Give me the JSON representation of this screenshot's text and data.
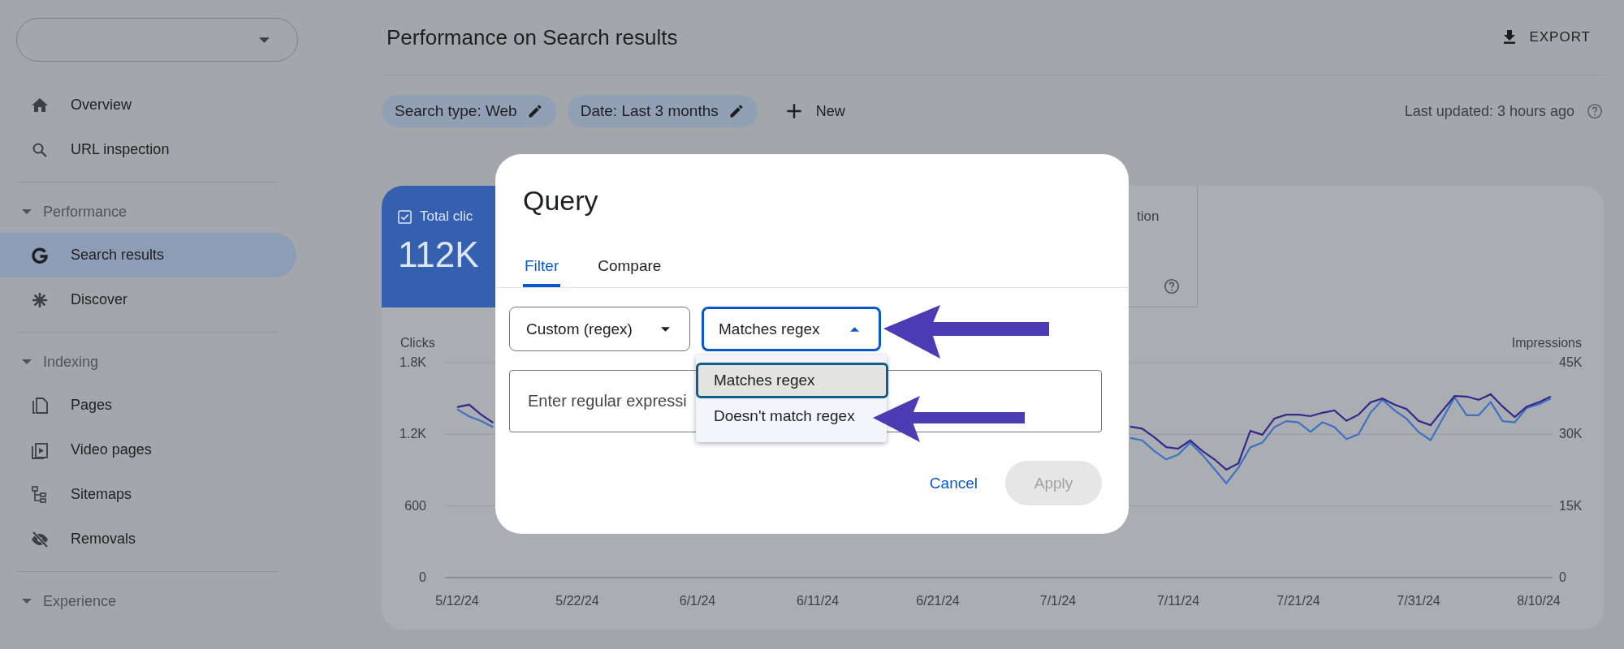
{
  "sidebar": {
    "sections": [
      {
        "items": [
          {
            "label": "Overview",
            "selected": false
          },
          {
            "label": "URL inspection",
            "selected": false
          }
        ]
      },
      {
        "heading": "Performance",
        "expanded": true,
        "items": [
          {
            "label": "Search results",
            "selected": true
          },
          {
            "label": "Discover",
            "selected": false
          }
        ]
      },
      {
        "heading": "Indexing",
        "expanded": true,
        "items": [
          {
            "label": "Pages",
            "selected": false
          },
          {
            "label": "Video pages",
            "selected": false
          },
          {
            "label": "Sitemaps",
            "selected": false
          },
          {
            "label": "Removals",
            "selected": false
          }
        ]
      },
      {
        "heading": "Experience",
        "expanded": true
      }
    ]
  },
  "header": {
    "title": "Performance on Search results",
    "export": "EXPORT",
    "filters": [
      {
        "label": "Search type: Web"
      },
      {
        "label": "Date: Last 3 months"
      }
    ],
    "new_filter": "New",
    "last_updated": "Last updated: 3 hours ago"
  },
  "performance_card": {
    "metrics": [
      {
        "label": "Total clic",
        "value": "112K",
        "selected": true,
        "checked": true
      },
      {
        "label": "tion",
        "selected": false
      }
    ],
    "chart_data": {
      "type": "line",
      "ylabel": "Clicks",
      "y2label": "Impressions",
      "categories": [
        "5/12/24",
        null,
        null,
        null,
        null,
        null,
        null,
        null,
        null,
        null,
        "5/22/24",
        null,
        null,
        null,
        null,
        null,
        null,
        null,
        null,
        null,
        "6/1/24",
        null,
        null,
        null,
        null,
        null,
        null,
        null,
        null,
        null,
        "6/11/24",
        null,
        null,
        null,
        null,
        null,
        null,
        null,
        null,
        null,
        "6/21/24",
        null,
        null,
        null,
        null,
        null,
        null,
        null,
        null,
        null,
        "7/1/24",
        null,
        null,
        null,
        null,
        null,
        null,
        null,
        null,
        null,
        "7/11/24",
        null,
        null,
        null,
        null,
        null,
        null,
        null,
        null,
        null,
        "7/21/24",
        null,
        null,
        null,
        null,
        null,
        null,
        null,
        null,
        null,
        "7/31/24",
        null,
        null,
        null,
        null,
        null,
        null,
        null,
        null,
        null,
        "8/10/24",
        null
      ],
      "series": [
        {
          "color": "#3f70c4",
          "values": [
            1410,
            1350,
            1310,
            1260,
            null,
            null,
            null,
            null,
            null,
            null,
            null,
            null,
            null,
            null,
            null,
            null,
            null,
            null,
            null,
            null,
            null,
            null,
            null,
            null,
            null,
            null,
            null,
            null,
            null,
            null,
            null,
            null,
            null,
            null,
            null,
            null,
            null,
            null,
            null,
            null,
            null,
            null,
            null,
            null,
            null,
            null,
            null,
            null,
            null,
            null,
            null,
            null,
            null,
            null,
            null,
            null,
            1170,
            1150,
            1060,
            990,
            1030,
            1130,
            1030,
            910,
            790,
            920,
            1090,
            1130,
            1260,
            1310,
            1300,
            1220,
            1300,
            1260,
            1160,
            1200,
            1380,
            1490,
            1400,
            1330,
            1220,
            1150,
            1330,
            1510,
            1360,
            1360,
            1470,
            1310,
            1300,
            1420,
            1450,
            1500
          ]
        },
        {
          "color": "#35288a",
          "axis": "y2",
          "values": [
            35700,
            36200,
            34100,
            32400,
            null,
            null,
            null,
            null,
            null,
            null,
            null,
            null,
            null,
            null,
            null,
            null,
            null,
            null,
            null,
            null,
            null,
            null,
            null,
            null,
            null,
            null,
            null,
            null,
            null,
            null,
            null,
            null,
            null,
            null,
            null,
            null,
            null,
            null,
            null,
            null,
            null,
            null,
            null,
            null,
            null,
            null,
            null,
            null,
            null,
            null,
            null,
            null,
            null,
            null,
            null,
            null,
            31600,
            31200,
            29400,
            27300,
            27000,
            28700,
            26500,
            24800,
            22600,
            23900,
            30700,
            29900,
            33300,
            34100,
            34100,
            33800,
            34500,
            35000,
            32800,
            34100,
            36700,
            37500,
            36200,
            35300,
            32800,
            31900,
            35000,
            38000,
            37900,
            37200,
            38400,
            35800,
            33600,
            35800,
            36700,
            37900
          ]
        }
      ],
      "ylim": [
        0,
        1800
      ],
      "y2lim": [
        0,
        45000
      ],
      "yticks": [
        {
          "value": 0,
          "label": "0"
        },
        {
          "value": 600,
          "label": "600"
        },
        {
          "value": 1200,
          "label": "1.2K"
        },
        {
          "value": 1800,
          "label": "1.8K"
        }
      ],
      "y2ticks": [
        {
          "value": 0,
          "label": "0"
        },
        {
          "value": 15000,
          "label": "15K"
        },
        {
          "value": 30000,
          "label": "30K"
        },
        {
          "value": 45000,
          "label": "45K"
        }
      ]
    }
  },
  "dialog": {
    "title": "Query",
    "tabs": [
      {
        "label": "Filter",
        "selected": true
      },
      {
        "label": "Compare",
        "selected": false
      }
    ],
    "field_select": {
      "value": "Custom (regex)",
      "expanded": false
    },
    "operator_select": {
      "value": "Matches regex",
      "expanded": true,
      "options": [
        {
          "label": "Matches regex",
          "selected": true
        },
        {
          "label": "Doesn't match regex",
          "selected": false
        }
      ]
    },
    "expression_input": {
      "placeholder": "Enter regular expressi"
    },
    "cancel_button": "Cancel",
    "apply_button": {
      "label": "Apply",
      "disabled": true
    }
  }
}
